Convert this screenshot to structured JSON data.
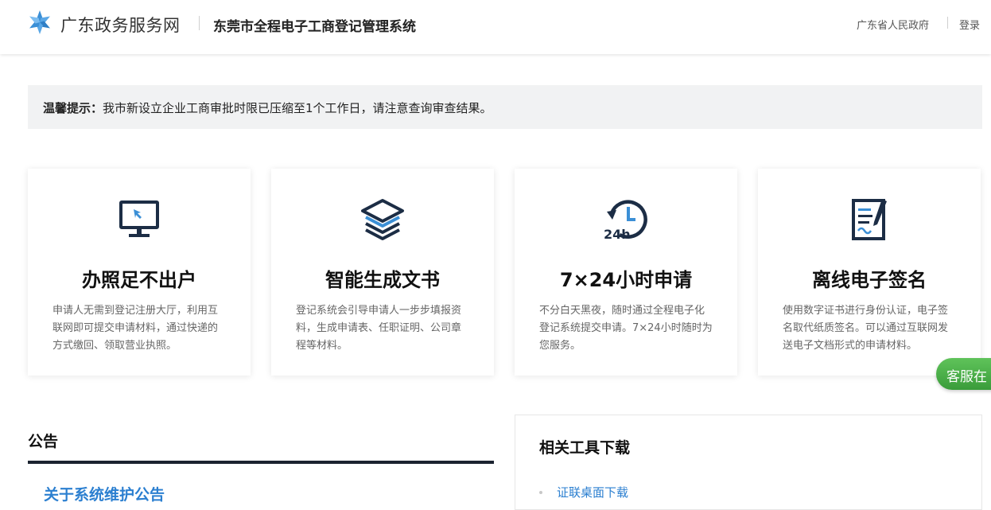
{
  "header": {
    "brand": "广东政务服务网",
    "system_title": "东莞市全程电子工商登记管理系统",
    "gov_link": "广东省人民政府",
    "login": "登录"
  },
  "notice": {
    "label": "温馨提示：",
    "text": "我市新设立企业工商审批时限已压缩至1个工作日，请注意查询审查结果。"
  },
  "cards": [
    {
      "icon": "monitor-cursor-icon",
      "title": "办照足不出户",
      "desc": "申请人无需到登记注册大厅，利用互联网即可提交申请材料，通过快递的方式缴回、领取营业执照。"
    },
    {
      "icon": "layers-icon",
      "title": "智能生成文书",
      "desc": "登记系统会引导申请人一步步填报资料，生成申请表、任职证明、公司章程等材料。"
    },
    {
      "icon": "clock-24h-icon",
      "title": "7×24小时申请",
      "desc": "不分白天黑夜，随时通过全程电子化登记系统提交申请。7×24小时随时为您服务。"
    },
    {
      "icon": "signed-document-icon",
      "title": "离线电子签名",
      "desc": "使用数字证书进行身份认证，电子签名取代纸质签名。可以通过互联网发送电子文档形式的申请材料。"
    }
  ],
  "chat": {
    "label": "客服在"
  },
  "bulletin": {
    "title": "公告",
    "items": [
      "关于系统维护公告"
    ]
  },
  "tools": {
    "title": "相关工具下载",
    "items": [
      "证联桌面下载"
    ]
  },
  "colors": {
    "icon_dark": "#1c2d45",
    "icon_accent": "#3b8fd6",
    "link": "#2b7fd0",
    "chat_green": "#4caf50",
    "notice_bg": "#f1f2f3"
  }
}
